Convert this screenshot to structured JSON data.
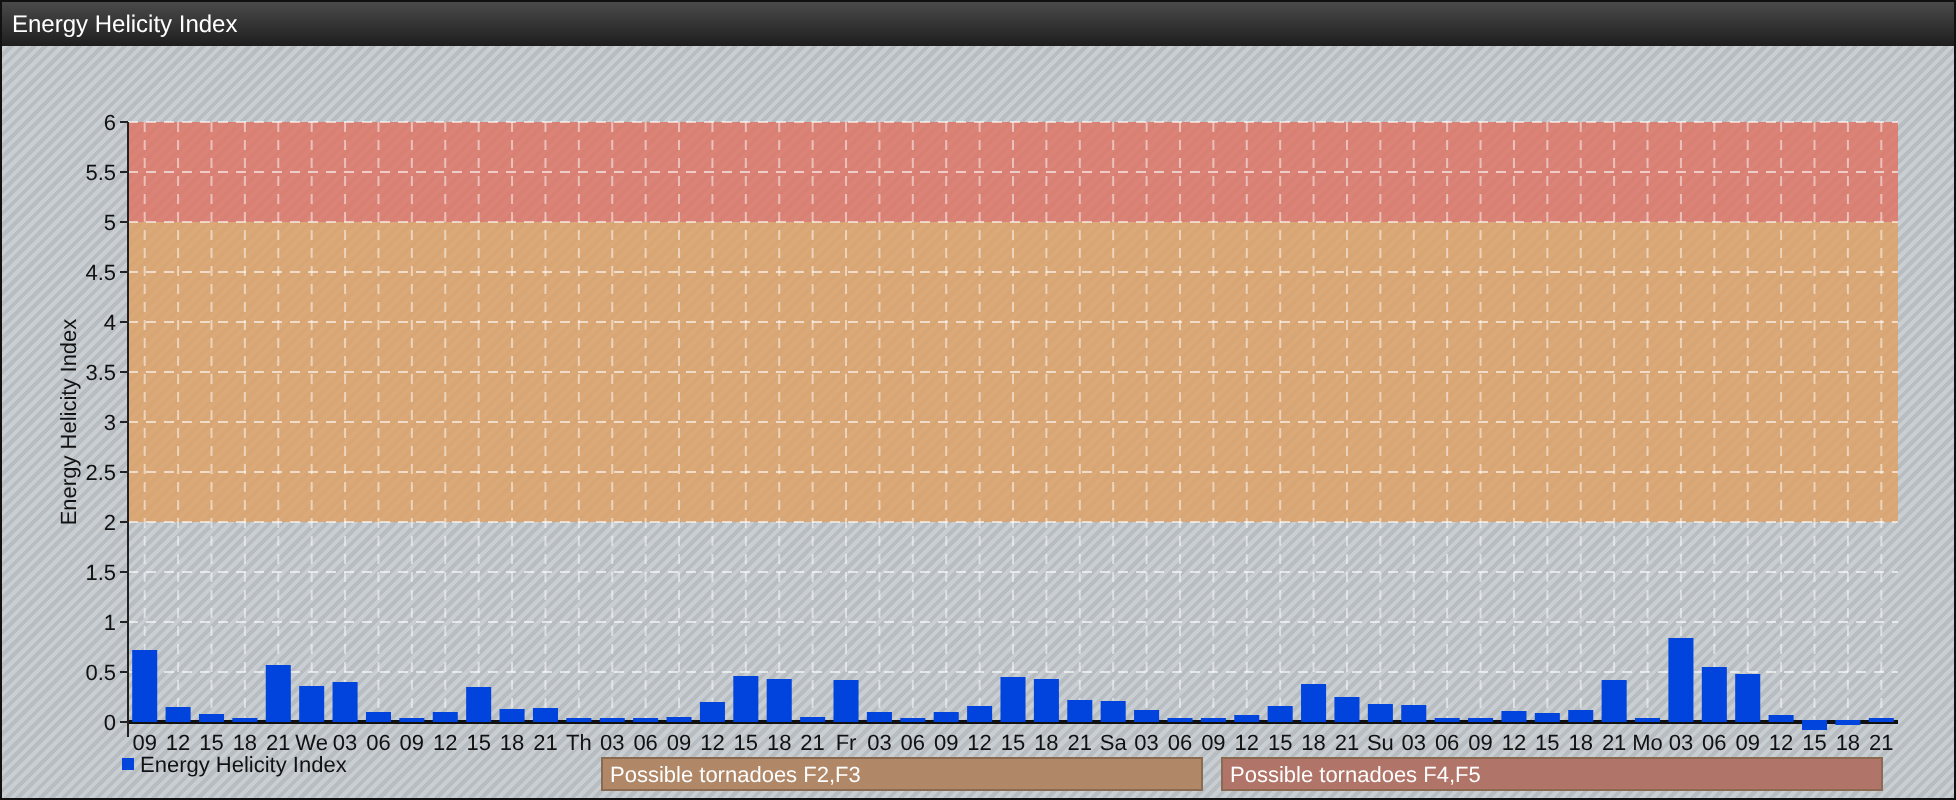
{
  "window": {
    "title": "Energy Helicity Index"
  },
  "chart": {
    "chart_data": {
      "type": "bar",
      "ylabel": "Energy Helicity Index",
      "categories": [
        "09",
        "12",
        "15",
        "18",
        "21",
        "We",
        "03",
        "06",
        "09",
        "12",
        "15",
        "18",
        "21",
        "Th",
        "03",
        "06",
        "09",
        "12",
        "15",
        "18",
        "21",
        "Fr",
        "03",
        "06",
        "09",
        "12",
        "15",
        "18",
        "21",
        "Sa",
        "03",
        "06",
        "09",
        "12",
        "15",
        "18",
        "21",
        "Su",
        "03",
        "06",
        "09",
        "12",
        "15",
        "18",
        "21",
        "Mo",
        "03",
        "06",
        "09",
        "12",
        "15",
        "18",
        "21"
      ],
      "series": [
        {
          "name": "Energy Helicity Index",
          "color": "#0044dd",
          "values": [
            0.72,
            0.15,
            0.08,
            0.04,
            0.57,
            0.36,
            0.4,
            0.1,
            0.04,
            0.1,
            0.35,
            0.13,
            0.14,
            0.04,
            0.04,
            0.04,
            0.05,
            0.2,
            0.46,
            0.43,
            0.05,
            0.42,
            0.1,
            0.04,
            0.1,
            0.16,
            0.45,
            0.43,
            0.22,
            0.21,
            0.12,
            0.04,
            0.04,
            0.07,
            0.16,
            0.38,
            0.25,
            0.18,
            0.17,
            0.04,
            0.04,
            0.11,
            0.09,
            0.12,
            0.42,
            0.04,
            0.84,
            0.55,
            0.48,
            0.07,
            -0.1,
            -0.05,
            0.04
          ]
        }
      ],
      "ylim": [
        -0.15,
        6
      ],
      "grid": true,
      "yticks": [
        0,
        {
          "value": 0.5,
          "label": "0.5"
        },
        1,
        {
          "value": 1.5,
          "label": "1.5"
        },
        2,
        {
          "value": 2.5,
          "label": "2.5"
        },
        3,
        {
          "value": 3.5,
          "label": "3.5"
        },
        4,
        {
          "value": 4.5,
          "label": "4.5"
        },
        5,
        {
          "value": 5.5,
          "label": "5.5"
        },
        6
      ],
      "bands": [
        {
          "axis": "y",
          "from": 2,
          "to": 5,
          "color": "#e0a060"
        },
        {
          "axis": "y",
          "from": 5,
          "to": 6,
          "color": "#e07060"
        }
      ]
    },
    "band_notes": [
      {
        "label": "Possible tornadoes F2,F3",
        "color": "#b08868"
      },
      {
        "label": "Possible tornadoes F4,F5",
        "color": "#b07468"
      }
    ]
  }
}
